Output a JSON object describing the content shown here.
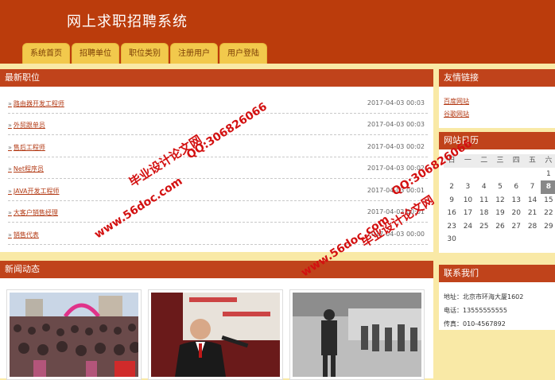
{
  "header": {
    "title": "网上求职招聘系统"
  },
  "nav": [
    {
      "label": "系统首页"
    },
    {
      "label": "招聘单位"
    },
    {
      "label": "职位类别"
    },
    {
      "label": "注册用户"
    },
    {
      "label": "用户登陆"
    }
  ],
  "latest_jobs": {
    "title": "最新职位",
    "items": [
      {
        "name": "路由器开发工程师",
        "date": "2017-04-03 00:03"
      },
      {
        "name": "外贸跟单员",
        "date": "2017-04-03 00:03"
      },
      {
        "name": "售后工程师",
        "date": "2017-04-03 00:02"
      },
      {
        "name": "Net程序员",
        "date": "2017-04-03 00:02"
      },
      {
        "name": "JAVA开发工程师",
        "date": "2017-04-03 00:01"
      },
      {
        "name": "大客户销售经理",
        "date": "2017-04-03 00:01"
      },
      {
        "name": "销售代表",
        "date": "2017-04-03 00:00"
      }
    ]
  },
  "news": {
    "title": "新闻动态"
  },
  "friend_links": {
    "title": "友情链接",
    "items": [
      {
        "label": "百度网站"
      },
      {
        "label": "谷歌网站"
      }
    ]
  },
  "calendar": {
    "title": "网站日历",
    "weekdays": [
      "日",
      "一",
      "二",
      "三",
      "四",
      "五",
      "六"
    ],
    "weeks": [
      [
        "",
        "",
        "",
        "",
        "",
        "",
        "1"
      ],
      [
        "2",
        "3",
        "4",
        "5",
        "6",
        "7",
        "8"
      ],
      [
        "9",
        "10",
        "11",
        "12",
        "13",
        "14",
        "15"
      ],
      [
        "16",
        "17",
        "18",
        "19",
        "20",
        "21",
        "22"
      ],
      [
        "23",
        "24",
        "25",
        "26",
        "27",
        "28",
        "29"
      ],
      [
        "30",
        "",
        "",
        "",
        "",
        "",
        ""
      ]
    ],
    "today": "8"
  },
  "contact": {
    "title": "联系我们",
    "address": "地址：北京市环海大厦1602",
    "phone": "电话：13555555555",
    "fax": "传真：010-4567892"
  },
  "watermarks": {
    "site": "www.56doc.com",
    "brand": "毕业设计论文网",
    "qq": "QQ:306826066"
  },
  "colors": {
    "header": "#bb3c0c",
    "panel_head": "#c0431b",
    "tab": "#f2c94c",
    "page_bg": "#f9e9a6"
  }
}
